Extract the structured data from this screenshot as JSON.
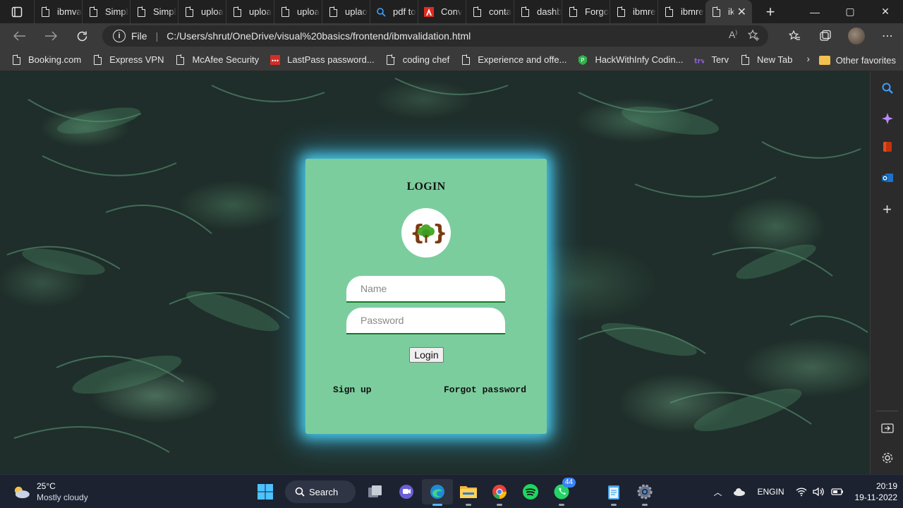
{
  "tabs": [
    {
      "label": "ibmva",
      "icon": "page-icon"
    },
    {
      "label": "Simpl",
      "icon": "page-icon"
    },
    {
      "label": "Simpl",
      "icon": "page-icon"
    },
    {
      "label": "uploa",
      "icon": "page-icon"
    },
    {
      "label": "uploa",
      "icon": "page-icon"
    },
    {
      "label": "uploa",
      "icon": "page-icon"
    },
    {
      "label": "uplao",
      "icon": "page-icon"
    },
    {
      "label": "pdf to",
      "icon": "search-icon"
    },
    {
      "label": "Conv",
      "icon": "adobe-icon"
    },
    {
      "label": "conta",
      "icon": "page-icon"
    },
    {
      "label": "dashb",
      "icon": "page-icon"
    },
    {
      "label": "Forgo",
      "icon": "page-icon"
    },
    {
      "label": "ibmre",
      "icon": "page-icon"
    },
    {
      "label": "ibmre",
      "icon": "page-icon"
    }
  ],
  "active_tab": {
    "label": "ik",
    "close": "✕"
  },
  "new_tab": "+",
  "window_controls": {
    "minimize": "—",
    "maximize": "▢",
    "close": "✕"
  },
  "address": {
    "scheme": "File",
    "separator": "|",
    "url": "C:/Users/shrut/OneDrive/visual%20basics/frontend/ibmvalidation.html"
  },
  "favorites": [
    {
      "label": "Booking.com",
      "icon": "page-icon"
    },
    {
      "label": "Express VPN",
      "icon": "page-icon"
    },
    {
      "label": "McAfee Security",
      "icon": "page-icon"
    },
    {
      "label": "LastPass password...",
      "icon": "lastpass-icon"
    },
    {
      "label": "coding chef",
      "icon": "page-icon"
    },
    {
      "label": "Experience and offe...",
      "icon": "page-icon"
    },
    {
      "label": "HackWithInfy Codin...",
      "icon": "hackwithinfy-icon"
    },
    {
      "label": "Terv",
      "icon": "terv-icon"
    },
    {
      "label": "New Tab",
      "icon": "page-icon"
    }
  ],
  "favorites_more": "›",
  "other_favorites": "Other favorites",
  "login": {
    "title": "LOGIN",
    "name_placeholder": "Name",
    "password_placeholder": "Password",
    "button": "Login",
    "signup": "Sign up",
    "forgot": "Forgot password"
  },
  "taskbar": {
    "temperature": "25°C",
    "condition": "Mostly cloudy",
    "search": "Search",
    "whatsapp_badge": "44",
    "lang_top": "ENG",
    "lang_bottom": "IN",
    "time": "20:19",
    "date": "19-11-2022"
  },
  "colors": {
    "card": "#7ccd9e",
    "card_glow": "#50dcff",
    "field_underline": "#127a2a"
  }
}
